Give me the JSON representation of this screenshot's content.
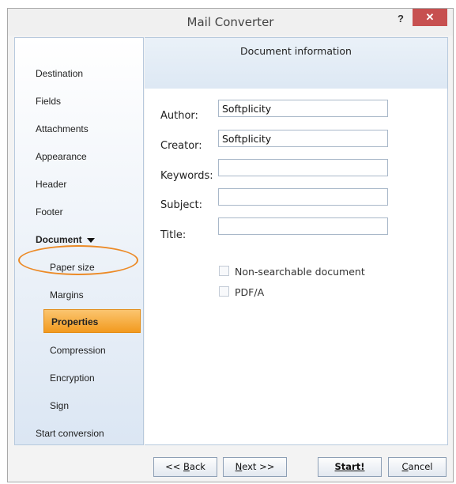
{
  "window": {
    "title": "Mail Converter",
    "help_label": "?",
    "close_label": "✕"
  },
  "sidebar": {
    "items": [
      {
        "label": "Destination"
      },
      {
        "label": "Fields"
      },
      {
        "label": "Attachments"
      },
      {
        "label": "Appearance"
      },
      {
        "label": "Header"
      },
      {
        "label": "Footer"
      },
      {
        "label": "Document"
      },
      {
        "label": "Paper size"
      },
      {
        "label": "Margins"
      },
      {
        "label": "Properties"
      },
      {
        "label": "Compression"
      },
      {
        "label": "Encryption"
      },
      {
        "label": "Sign"
      },
      {
        "label": "Start conversion"
      }
    ],
    "selected": "Properties"
  },
  "main": {
    "heading": "Document information",
    "fields": [
      {
        "label": "Author:",
        "value": "Softplicity"
      },
      {
        "label": "Creator:",
        "value": "Softplicity"
      },
      {
        "label": "Keywords:",
        "value": ""
      },
      {
        "label": "Subject:",
        "value": ""
      },
      {
        "label": "Title:",
        "value": ""
      }
    ],
    "checkboxes": [
      {
        "label": "Non-searchable document",
        "checked": false
      },
      {
        "label": "PDF/A",
        "checked": false
      }
    ]
  },
  "footer": {
    "back": {
      "prefix": "<< ",
      "mnemonic": "B",
      "rest": "ack"
    },
    "next": {
      "mnemonic": "N",
      "rest": "ext >>"
    },
    "start": {
      "label": "Start!"
    },
    "cancel": {
      "mnemonic": "C",
      "rest": "ancel"
    }
  },
  "colors": {
    "accent": "#f29a1f",
    "highlight_ring": "#ec8a26",
    "close_button": "#c75050"
  }
}
